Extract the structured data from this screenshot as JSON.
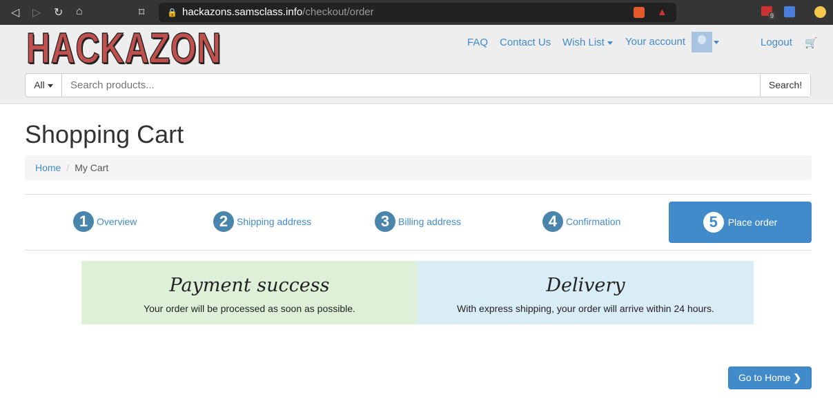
{
  "browser": {
    "url_host": "hackazons.samsclass.info",
    "url_path": "/checkout/order",
    "extension_badge": "9"
  },
  "header": {
    "logo": "HACKAZON",
    "nav": {
      "faq": "FAQ",
      "contact": "Contact Us",
      "wishlist": "Wish List",
      "account": "Your account",
      "logout": "Logout"
    },
    "search": {
      "category": "All",
      "placeholder": "Search products...",
      "button": "Search!"
    }
  },
  "page": {
    "title": "Shopping Cart",
    "breadcrumb": [
      "Home",
      "My Cart"
    ]
  },
  "steps": [
    {
      "num": "1",
      "label": "Overview"
    },
    {
      "num": "2",
      "label": "Shipping address"
    },
    {
      "num": "3",
      "label": "Billing address"
    },
    {
      "num": "4",
      "label": "Confirmation"
    },
    {
      "num": "5",
      "label": "Place order"
    }
  ],
  "panels": {
    "payment": {
      "title": "Payment success",
      "text": "Your order will be processed as soon as possible.",
      "color": "#dff0d8"
    },
    "delivery": {
      "title": "Delivery",
      "text": "With express shipping, your order will arrive within 24 hours.",
      "color": "#d9edf7"
    }
  },
  "go_home": "Go to Home"
}
